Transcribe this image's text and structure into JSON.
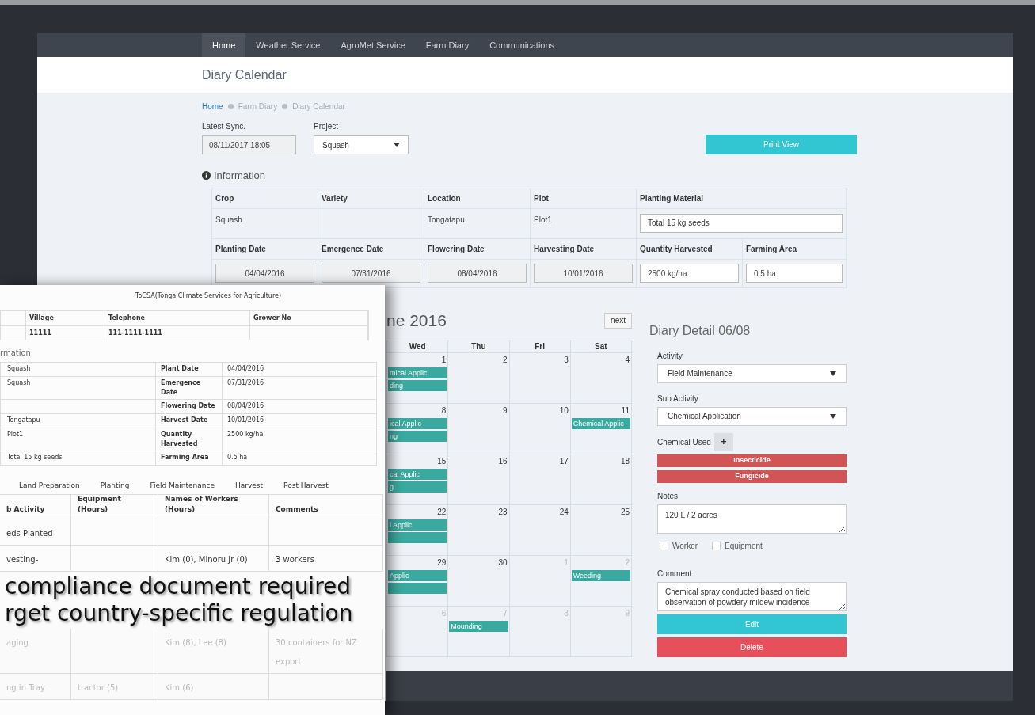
{
  "nav": {
    "tabs": [
      {
        "label": "Home",
        "selected": true
      },
      {
        "label": "Weather Service",
        "selected": false
      },
      {
        "label": "AgroMet Service",
        "selected": false
      },
      {
        "label": "Farm Diary",
        "selected": false
      },
      {
        "label": "Communications",
        "selected": false
      }
    ]
  },
  "page_title": "Diary Calendar",
  "breadcrumb": [
    {
      "label": "Home",
      "link": true
    },
    {
      "label": "Farm Diary",
      "link": false
    },
    {
      "label": "Diary Calendar",
      "link": false
    }
  ],
  "sync": {
    "label": "Latest Sync.",
    "value": "08/11/2017 18:05"
  },
  "project": {
    "label": "Project",
    "value": "Squash"
  },
  "print_button": "Print View",
  "information": {
    "title": "Information",
    "row1": [
      {
        "label": "Crop",
        "value": "Squash",
        "kind": "text"
      },
      {
        "label": "Variety",
        "kind": "text"
      },
      {
        "label": "Location",
        "value": "Tongatapu",
        "kind": "text"
      },
      {
        "label": "Plot",
        "value": "Plot1",
        "kind": "text"
      },
      {
        "label": "Planting Material",
        "value": "Total 15 kg seeds",
        "kind": "input"
      }
    ],
    "row2": [
      {
        "label": "Planting Date",
        "value": "04/04/2016",
        "kind": "readonly"
      },
      {
        "label": "Emergence Date",
        "value": "07/31/2016",
        "kind": "readonly"
      },
      {
        "label": "Flowering Date",
        "value": "08/04/2016",
        "kind": "readonly"
      },
      {
        "label": "Harvesting Date",
        "value": "10/01/2016",
        "kind": "readonly"
      },
      {
        "label": "Quantity Harvested",
        "value": "2500 kg/ha",
        "kind": "input"
      },
      {
        "label": "Farming Area",
        "value": "0.5 ha",
        "kind": "input"
      }
    ]
  },
  "calendar": {
    "title": "ne 2016",
    "next": "next",
    "days": [
      "Wed",
      "Thu",
      "Fri",
      "Sat"
    ],
    "weeks": [
      [
        {
          "day": "1",
          "muted": false,
          "events": [
            {
              "kind": "labeled",
              "text": "mical Applic"
            },
            {
              "kind": "labeled",
              "text": "ding"
            }
          ]
        },
        {
          "day": "2",
          "muted": false
        },
        {
          "day": "3",
          "muted": false
        },
        {
          "day": "4",
          "muted": false
        }
      ],
      [
        {
          "day": "8",
          "muted": false,
          "events": [
            {
              "kind": "labeled",
              "text": "ical Applic"
            },
            {
              "kind": "labeled",
              "text": "ng"
            }
          ]
        },
        {
          "day": "9",
          "muted": false
        },
        {
          "day": "10",
          "muted": false
        },
        {
          "day": "11",
          "muted": false,
          "events": [
            {
              "kind": "labeled",
              "text": "Chemical Applic"
            }
          ]
        }
      ],
      [
        {
          "day": "15",
          "muted": false,
          "events": [
            {
              "kind": "labeled",
              "text": "cal Applic"
            },
            {
              "kind": "labeled",
              "text": "g"
            }
          ]
        },
        {
          "day": "16",
          "muted": false
        },
        {
          "day": "17",
          "muted": false
        },
        {
          "day": "18",
          "muted": false
        }
      ],
      [
        {
          "day": "22",
          "muted": false,
          "events": [
            {
              "kind": "labeled",
              "text": "l Applic"
            },
            {
              "kind": "blank"
            }
          ]
        },
        {
          "day": "23",
          "muted": false
        },
        {
          "day": "24",
          "muted": false
        },
        {
          "day": "25",
          "muted": false
        }
      ],
      [
        {
          "day": "29",
          "muted": false,
          "events": [
            {
              "kind": "labeled",
              "text": "Applic"
            },
            {
              "kind": "blank"
            }
          ]
        },
        {
          "day": "30",
          "muted": false
        },
        {
          "day": "1",
          "muted": true
        },
        {
          "day": "2",
          "muted": true,
          "events": [
            {
              "kind": "labeled",
              "text": "Weeding"
            }
          ]
        }
      ],
      [
        {
          "day": "6",
          "muted": true
        },
        {
          "day": "7",
          "muted": true,
          "events": [
            {
              "kind": "labeled",
              "text": "Mounding"
            }
          ]
        },
        {
          "day": "8",
          "muted": true
        },
        {
          "day": "9",
          "muted": true
        }
      ]
    ]
  },
  "detail": {
    "title": "Diary Detail 06/08",
    "activity": {
      "label": "Activity",
      "value": "Field Maintenance"
    },
    "sub_activity": {
      "label": "Sub Activity",
      "value": "Chemical Application"
    },
    "chemicals": {
      "label": "Chemical Used",
      "add": "+",
      "items": [
        "Insecticide",
        "Fungicide"
      ]
    },
    "notes": {
      "label": "Notes",
      "value": "120 L / 2 acres"
    },
    "checkboxes": [
      {
        "label": "Worker",
        "checked": false
      },
      {
        "label": "Equipment",
        "checked": false
      }
    ],
    "comment": {
      "label": "Comment",
      "value": "Chemical spray conducted based on field observation of powdery mildew incidence"
    },
    "buttons": [
      {
        "label": "Edit",
        "kind": "primary"
      },
      {
        "label": "Delete",
        "kind": "danger"
      }
    ]
  },
  "document": {
    "title": "ToCSA(Tonga Climate Services for Agriculture)",
    "grower_columns": [
      "Village",
      "Telephone",
      "Grower No"
    ],
    "grower_values": [
      "11111",
      "111-1111-1111"
    ],
    "section": "rmation",
    "info_rows": [
      [
        "Squash",
        "Plant Date",
        "04/04/2016"
      ],
      [
        "Squash",
        "Emergence Date",
        "07/31/2016"
      ],
      [
        "",
        "Flowering Date",
        "08/04/2016"
      ],
      [
        "Tongatapu",
        "Harvest Date",
        "10/01/2016"
      ],
      [
        "Plot1",
        "Quantity Harvested",
        "2500 kg/ha"
      ],
      [
        "Total 15 kg seeds",
        "Farming Area",
        "0.5 ha"
      ]
    ],
    "stages": [
      "Land Preparation",
      "Planting",
      "Field Maintenance",
      "Harvest",
      "Post Harvest"
    ],
    "activity_columns": [
      "b Activity",
      "Equipment (Hours)",
      "Names of Workers (Hours)",
      "Comments"
    ],
    "activity_rows": [
      {
        "cells": [
          "eds Planted",
          null,
          null,
          null
        ],
        "faded": false
      },
      {
        "cells": [
          "vesting-",
          null,
          "Kim (0), Minoru Jr (0)",
          "3 workers"
        ],
        "faded": false
      }
    ],
    "faded_rows": [
      {
        "cells": [
          "aging",
          null,
          "Kim (8), Lee (8)",
          "30 containers for NZ export"
        ],
        "faded": true
      },
      {
        "cells": [
          "ng in Tray",
          "tractor (5)",
          "Kim (6)",
          null
        ],
        "faded": true
      }
    ],
    "caption": [
      "compliance document required",
      "rget country-specific regulation"
    ]
  }
}
